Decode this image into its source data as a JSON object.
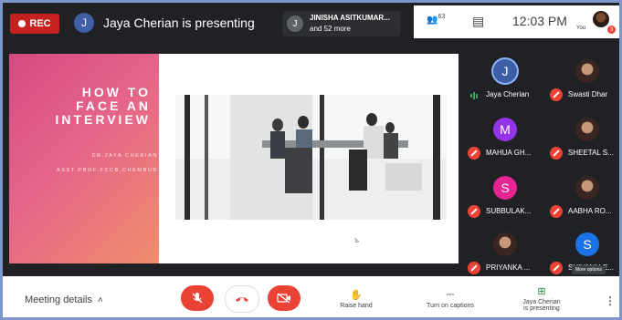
{
  "topbar": {
    "rec_label": "REC",
    "presenter_initial": "J",
    "presenting_text": "Jaya Cherian is presenting",
    "chip": {
      "initial": "J",
      "line1": "JINISHA ASITKUMAR...",
      "line2": "and 52 more"
    },
    "people_count": "63",
    "time": "12:03 PM",
    "you_label": "You",
    "badge": "3"
  },
  "slide": {
    "title_lines": [
      "HOW TO",
      "FACE AN",
      "INTERVIEW"
    ],
    "author_lines": [
      "DR.JAYA CHERIAN",
      "ASST.PROF.FCCB,CHEMBUR"
    ],
    "cursor_mark": "ъ"
  },
  "participants": [
    {
      "name": "Jaya Cherian",
      "initial": "J",
      "color": "#3f5ea8",
      "status": "speaking"
    },
    {
      "name": "Swasti Dhar",
      "photo": true,
      "status": "muted"
    },
    {
      "name": "MAHUA GH...",
      "initial": "M",
      "color": "#9334e6",
      "status": "muted"
    },
    {
      "name": "SHEETAL S...",
      "photo": true,
      "status": "muted"
    },
    {
      "name": "SUBBULAK...",
      "initial": "S",
      "color": "#e52592",
      "status": "muted"
    },
    {
      "name": "AABHA RO...",
      "photo": true,
      "status": "muted"
    },
    {
      "name": "PRIYANKA ...",
      "photo": true,
      "status": "muted"
    },
    {
      "name": "SHIVANI LE...",
      "initial": "S",
      "color": "#1a73e8",
      "status": "muted"
    }
  ],
  "more_options_tooltip": "More options",
  "bottombar": {
    "meeting_details": "Meeting details",
    "raise_hand": "Raise hand",
    "captions": "Turn on captions",
    "presenting_line1": "Jaya Cherian",
    "presenting_line2": "is presenting"
  },
  "colors": {
    "accent_red": "#ea4335",
    "rec_red": "#c5221f",
    "bg_dark": "#202124"
  }
}
